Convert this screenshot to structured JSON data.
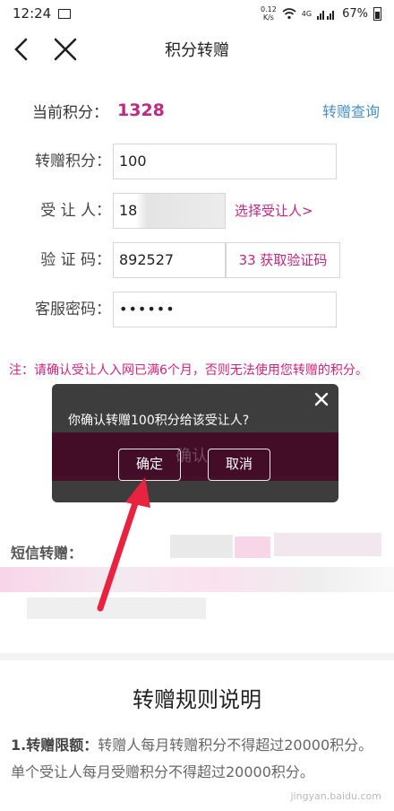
{
  "status_bar": {
    "time": "12:24",
    "net_speed_value": "0.12",
    "net_speed_unit": "K/s",
    "network": "4G",
    "battery": "67%"
  },
  "nav": {
    "title": "积分转赠"
  },
  "points": {
    "label": "当前积分：",
    "value": "1328",
    "query_link": "转赠查询"
  },
  "form": {
    "amount_label": "转赠积分：",
    "amount_value": "100",
    "recipient_label": "受 让 人：",
    "recipient_value": "18",
    "select_recipient": "选择受让人>",
    "code_label": "验 证 码：",
    "code_value": "892527",
    "code_button": "33 获取验证码",
    "password_label": "客服密码：",
    "password_value": "••••••"
  },
  "note": "注：请确认受让人入网已满6个月，否则无法使用您转赠的积分。",
  "dialog": {
    "message": "你确认转赠100积分给该受让人?",
    "ok_label": "确定",
    "cancel_label": "取消",
    "background_button": "确认"
  },
  "sms": {
    "label": "短信转赠："
  },
  "rules": {
    "title": "转赠规则说明",
    "item1_title": "1.转赠限额：",
    "item1_text": "转赠人每月转赠积分不得超过20000积分。单个受让人每月受赠积分不得超过20000积分。"
  },
  "watermark": "jingyan.baidu.com"
}
